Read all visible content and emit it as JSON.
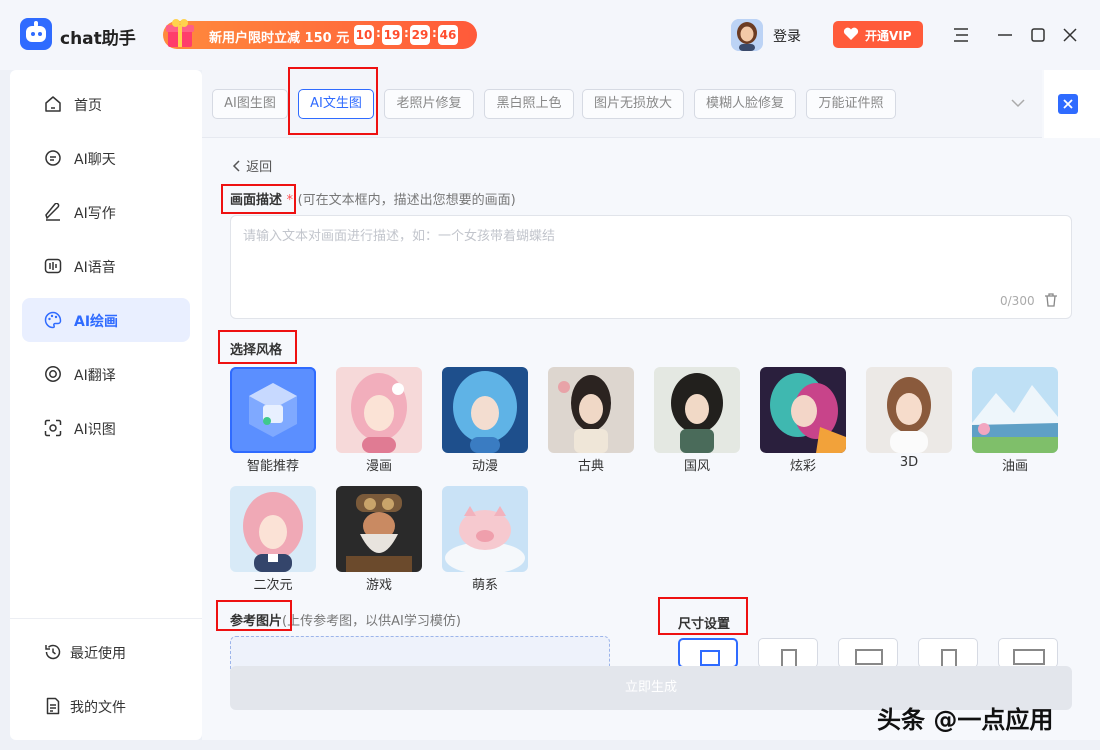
{
  "app": {
    "name": "chat助手"
  },
  "promo": {
    "text": "新用户限时立减 150 元",
    "hours": "10",
    "minutes": "19",
    "seconds": "29",
    "ms": "46",
    "colon": ":"
  },
  "header": {
    "login": "登录",
    "vip": "开通VIP"
  },
  "sidebar": {
    "items": [
      {
        "label": "首页",
        "icon": "home-icon"
      },
      {
        "label": "AI聊天",
        "icon": "chat-icon"
      },
      {
        "label": "AI写作",
        "icon": "pen-icon"
      },
      {
        "label": "AI语音",
        "icon": "voice-icon"
      },
      {
        "label": "AI绘画",
        "icon": "palette-icon",
        "active": true
      },
      {
        "label": "AI翻译",
        "icon": "translate-icon"
      },
      {
        "label": "AI识图",
        "icon": "scan-icon"
      }
    ],
    "bottom": [
      {
        "label": "最近使用",
        "icon": "history-icon"
      },
      {
        "label": "我的文件",
        "icon": "file-icon"
      }
    ]
  },
  "tabs": [
    "AI图生图",
    "AI文生图",
    "老照片修复",
    "黑白照上色",
    "图片无损放大",
    "模糊人脸修复",
    "万能证件照"
  ],
  "active_tab": 1,
  "back_label": "返回",
  "desc": {
    "title": "画面描述",
    "required": "*",
    "hint": "(可在文本框内，描述出您想要的画面)",
    "placeholder": "请输入文本对画面进行描述，如：一个女孩带着蝴蝶结",
    "counter": "0/300"
  },
  "style": {
    "title": "选择风格",
    "options": [
      "智能推荐",
      "漫画",
      "动漫",
      "古典",
      "国风",
      "炫彩",
      "3D",
      "油画",
      "二次元",
      "游戏",
      "萌系"
    ],
    "selected": 0
  },
  "reference": {
    "title": "参考图片",
    "hint": "(上传参考图，以供AI学习模仿)"
  },
  "size": {
    "title": "尺寸设置"
  },
  "generate_label": "立即生成",
  "watermark": "头条 @一点应用",
  "colors": {
    "accent": "#2f6bff",
    "promo": "#ff5a3a",
    "annotation": "#ee1111"
  }
}
